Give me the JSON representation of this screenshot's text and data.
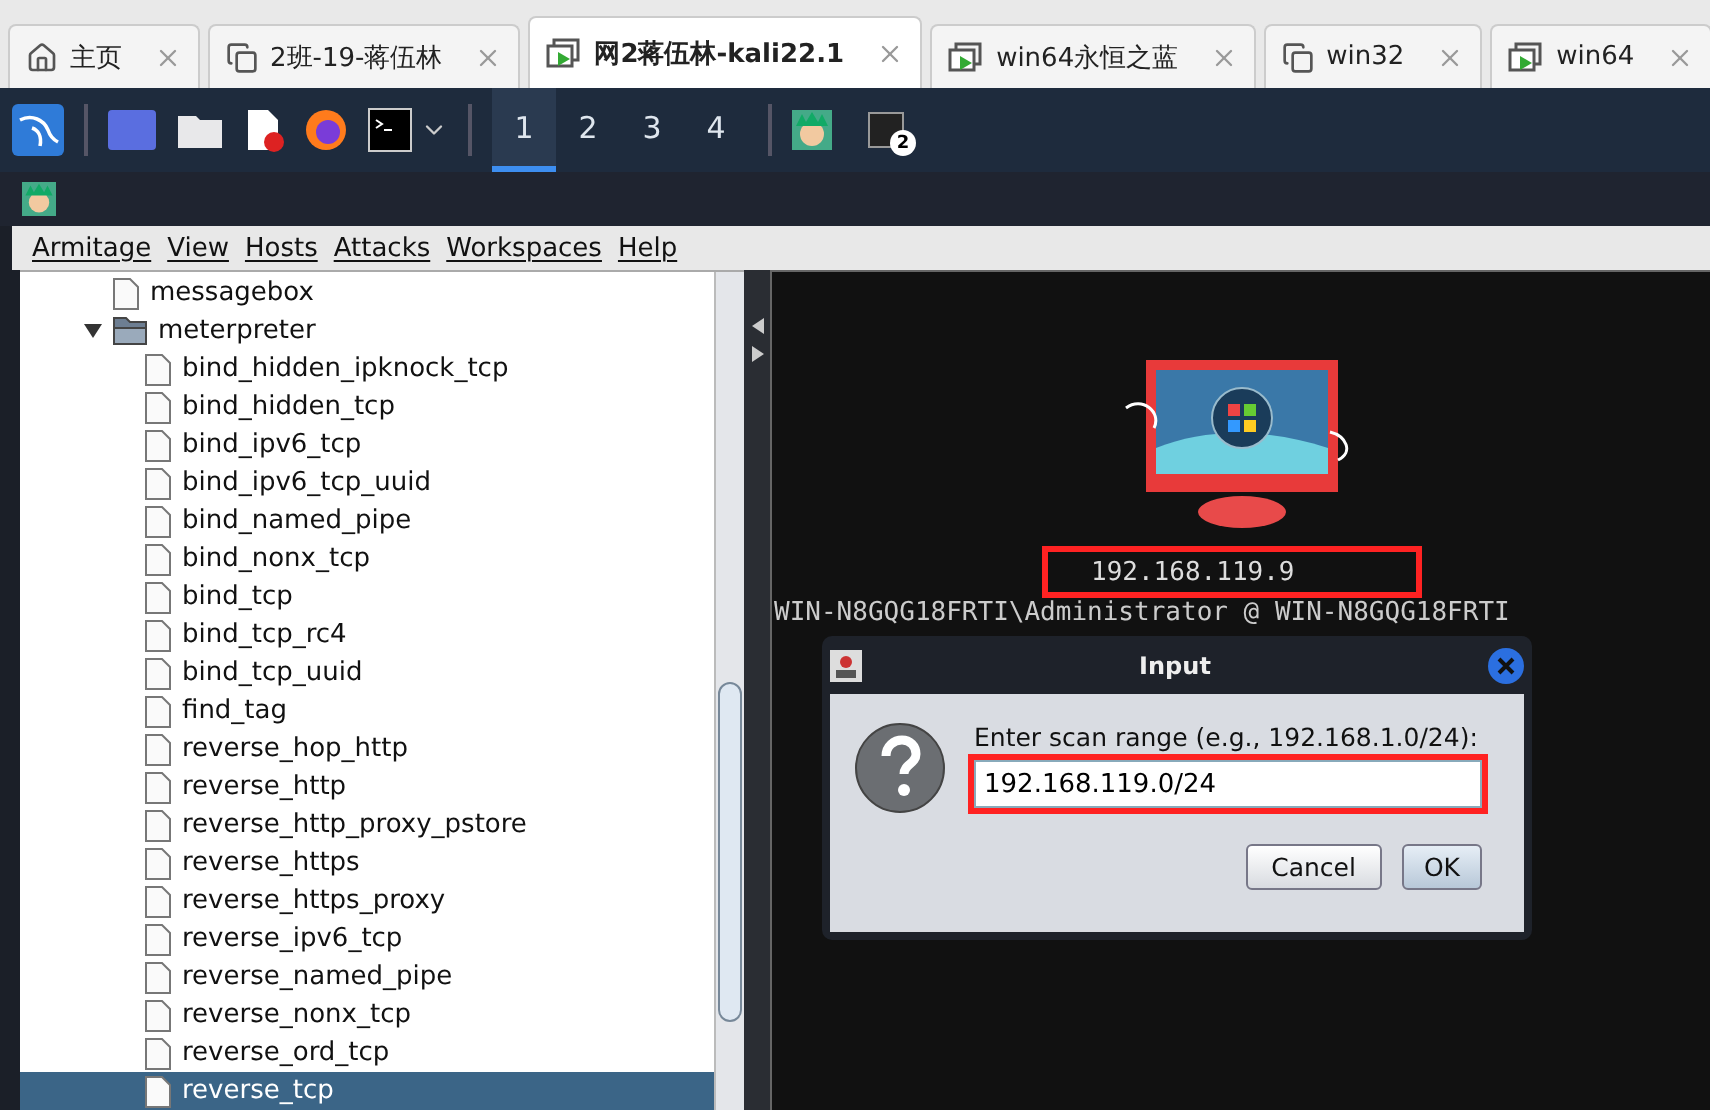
{
  "browser_tabs": [
    {
      "label": "主页",
      "kind": "home",
      "selected": false
    },
    {
      "label": "2班-19-蒋伍林",
      "kind": "vm",
      "selected": false
    },
    {
      "label": "网2蒋伍林-kali22.1",
      "kind": "vm-running",
      "selected": true
    },
    {
      "label": "win64永恒之蓝",
      "kind": "vm-running",
      "selected": false
    },
    {
      "label": "win32",
      "kind": "vm",
      "selected": false
    },
    {
      "label": "win64",
      "kind": "vm-running",
      "selected": false
    }
  ],
  "taskbar": {
    "workspaces": [
      {
        "label": "1",
        "selected": true
      },
      {
        "label": "2",
        "selected": false
      },
      {
        "label": "3",
        "selected": false
      },
      {
        "label": "4",
        "selected": false
      }
    ],
    "terminal_badge": "2"
  },
  "menu": [
    "Armitage",
    "View",
    "Hosts",
    "Attacks",
    "Workspaces",
    "Help"
  ],
  "tree": [
    {
      "label": "messagebox",
      "kind": "file",
      "selected": false
    },
    {
      "label": "meterpreter",
      "kind": "folder",
      "expanded": true,
      "selected": false,
      "children": [
        {
          "label": "bind_hidden_ipknock_tcp",
          "kind": "file",
          "selected": false
        },
        {
          "label": "bind_hidden_tcp",
          "kind": "file",
          "selected": false
        },
        {
          "label": "bind_ipv6_tcp",
          "kind": "file",
          "selected": false
        },
        {
          "label": "bind_ipv6_tcp_uuid",
          "kind": "file",
          "selected": false
        },
        {
          "label": "bind_named_pipe",
          "kind": "file",
          "selected": false
        },
        {
          "label": "bind_nonx_tcp",
          "kind": "file",
          "selected": false
        },
        {
          "label": "bind_tcp",
          "kind": "file",
          "selected": false
        },
        {
          "label": "bind_tcp_rc4",
          "kind": "file",
          "selected": false
        },
        {
          "label": "bind_tcp_uuid",
          "kind": "file",
          "selected": false
        },
        {
          "label": "find_tag",
          "kind": "file",
          "selected": false
        },
        {
          "label": "reverse_hop_http",
          "kind": "file",
          "selected": false
        },
        {
          "label": "reverse_http",
          "kind": "file",
          "selected": false
        },
        {
          "label": "reverse_http_proxy_pstore",
          "kind": "file",
          "selected": false
        },
        {
          "label": "reverse_https",
          "kind": "file",
          "selected": false
        },
        {
          "label": "reverse_https_proxy",
          "kind": "file",
          "selected": false
        },
        {
          "label": "reverse_ipv6_tcp",
          "kind": "file",
          "selected": false
        },
        {
          "label": "reverse_named_pipe",
          "kind": "file",
          "selected": false
        },
        {
          "label": "reverse_nonx_tcp",
          "kind": "file",
          "selected": false
        },
        {
          "label": "reverse_ord_tcp",
          "kind": "file",
          "selected": false
        },
        {
          "label": "reverse_tcp",
          "kind": "file",
          "selected": true
        }
      ]
    }
  ],
  "host": {
    "address": "192.168.119.9",
    "label": "WIN-N8GQG18FRTI\\Administrator @ WIN-N8GQG18FRTI"
  },
  "dialog": {
    "title": "Input",
    "prompt": "Enter scan range (e.g., 192.168.1.0/24):",
    "value": "192.168.119.0/24",
    "buttons": [
      "Cancel",
      "OK"
    ]
  }
}
